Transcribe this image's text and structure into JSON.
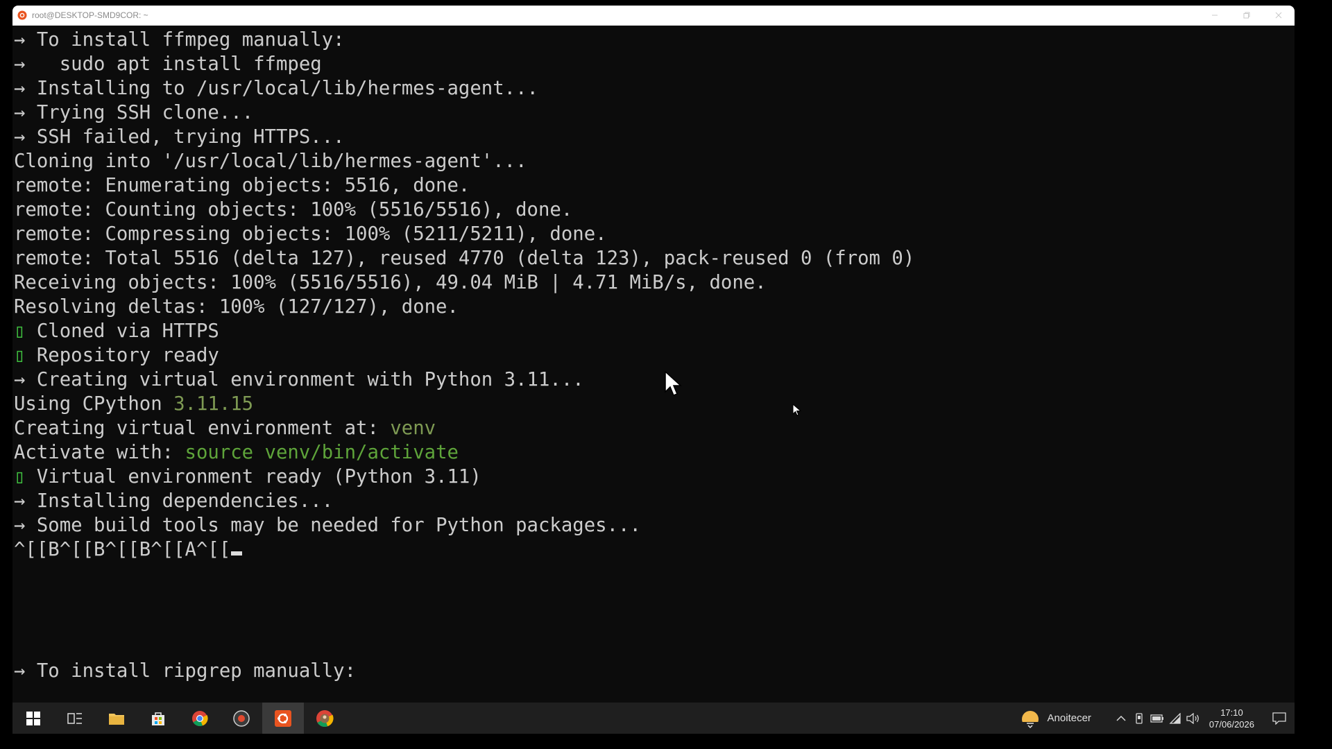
{
  "window": {
    "title": "root@DESKTOP-SMD9COR: ~"
  },
  "terminal": {
    "lines": [
      {
        "prefix": "→ ",
        "text": "To install ffmpeg manually:"
      },
      {
        "prefix": "→ ",
        "text": "  sudo apt install ffmpeg"
      },
      {
        "prefix": "→ ",
        "text": "Installing to /usr/local/lib/hermes-agent..."
      },
      {
        "prefix": "→ ",
        "text": "Trying SSH clone..."
      },
      {
        "prefix": "→ ",
        "text": "SSH failed, trying HTTPS..."
      },
      {
        "text": "Cloning into '/usr/local/lib/hermes-agent'..."
      },
      {
        "text": "remote: Enumerating objects: 5516, done."
      },
      {
        "text": "remote: Counting objects: 100% (5516/5516), done."
      },
      {
        "text": "remote: Compressing objects: 100% (5211/5211), done."
      },
      {
        "text": "remote: Total 5516 (delta 127), reused 4770 (delta 123), pack-reused 0 (from 0)"
      },
      {
        "text": "Receiving objects: 100% (5516/5516), 49.04 MiB | 4.71 MiB/s, done."
      },
      {
        "text": "Resolving deltas: 100% (127/127), done."
      },
      {
        "prefix": "▯ ",
        "text": "Cloned via HTTPS"
      },
      {
        "prefix": "▯ ",
        "text": "Repository ready"
      },
      {
        "prefix": "→ ",
        "text": "Creating virtual environment with Python 3.11..."
      },
      {
        "text": "Using CPython ",
        "value": "3.11.15"
      },
      {
        "text": "Creating virtual environment at: ",
        "value": "venv"
      },
      {
        "text": "Activate with: ",
        "value": "source venv/bin/activate"
      },
      {
        "prefix": "▯ ",
        "text": "Virtual environment ready (Python 3.11)"
      },
      {
        "prefix": "→ ",
        "text": "Installing dependencies..."
      },
      {
        "prefix": "→ ",
        "text": "Some build tools may be needed for Python packages..."
      },
      {
        "text": "^[[B^[[B^[[B^[[A^[["
      },
      {
        "prefix": "→ ",
        "text": "To install ripgrep manually:"
      }
    ]
  },
  "taskbar": {
    "weather_text": "Anoitecer",
    "clock_time": "17:10",
    "clock_date": "07/06/2026"
  },
  "colors": {
    "terminal_bg": "#0c0c0c",
    "terminal_fg": "#cccccc",
    "dim_green": "#7e9a53",
    "bright_green": "#5ea43a",
    "taskbar_bg": "#1f1f1f"
  }
}
